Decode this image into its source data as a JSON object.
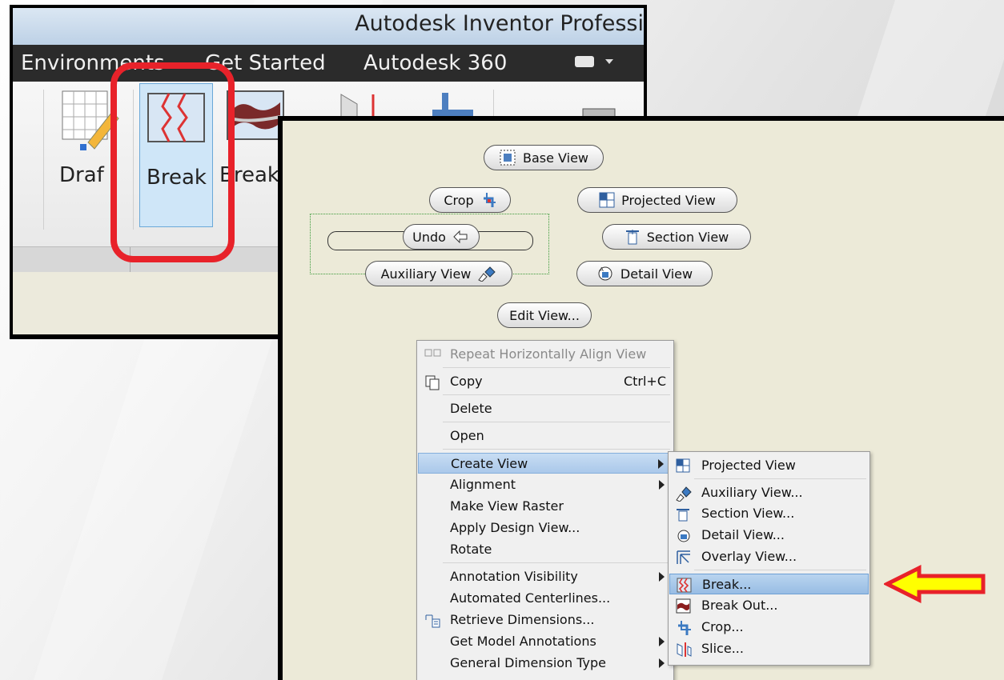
{
  "window": {
    "title": "Autodesk Inventor Professi"
  },
  "ribbon_tabs": [
    "Environments",
    "Get Started",
    "Autodesk 360"
  ],
  "ribbon_tools": {
    "draft": "Draf",
    "break": "Break",
    "break_out": "Break"
  },
  "canvas_buttons": {
    "base_view": "Base View",
    "crop": "Crop",
    "projected_view": "Projected View",
    "undo": "Undo",
    "section_view": "Section View",
    "auxiliary_view": "Auxiliary View",
    "detail_view": "Detail View",
    "edit_view": "Edit View..."
  },
  "context_menu": [
    {
      "label": "Repeat Horizontally Align View",
      "disabled": true
    },
    {
      "label": "Copy",
      "shortcut": "Ctrl+C"
    },
    {
      "label": "Delete"
    },
    {
      "label": "Open"
    },
    {
      "label": "Create View",
      "submenu": true,
      "highlighted": true
    },
    {
      "label": "Alignment",
      "submenu": true
    },
    {
      "label": "Make View Raster"
    },
    {
      "label": "Apply Design View..."
    },
    {
      "label": "Rotate"
    },
    {
      "label": "Annotation Visibility",
      "submenu": true
    },
    {
      "label": "Automated Centerlines..."
    },
    {
      "label": "Retrieve Dimensions..."
    },
    {
      "label": "Get Model Annotations",
      "submenu": true
    },
    {
      "label": "General Dimension Type",
      "submenu": true
    }
  ],
  "create_view_submenu": [
    {
      "label": "Projected View",
      "icon": "projected-view-icon"
    },
    {
      "label": "Auxiliary View...",
      "icon": "auxiliary-view-icon"
    },
    {
      "label": "Section View...",
      "icon": "section-view-icon"
    },
    {
      "label": "Detail View...",
      "icon": "detail-view-icon"
    },
    {
      "label": "Overlay View...",
      "icon": "overlay-view-icon"
    },
    {
      "label": "Break...",
      "icon": "break-icon",
      "highlighted": true
    },
    {
      "label": "Break Out...",
      "icon": "break-out-icon"
    },
    {
      "label": "Crop...",
      "icon": "crop-icon"
    },
    {
      "label": "Slice...",
      "icon": "slice-icon"
    }
  ],
  "colors": {
    "highlight_box": "#e8222a",
    "arrow_fill": "#ffff00",
    "arrow_stroke": "#e8222a",
    "canvas": "#ecead8"
  }
}
